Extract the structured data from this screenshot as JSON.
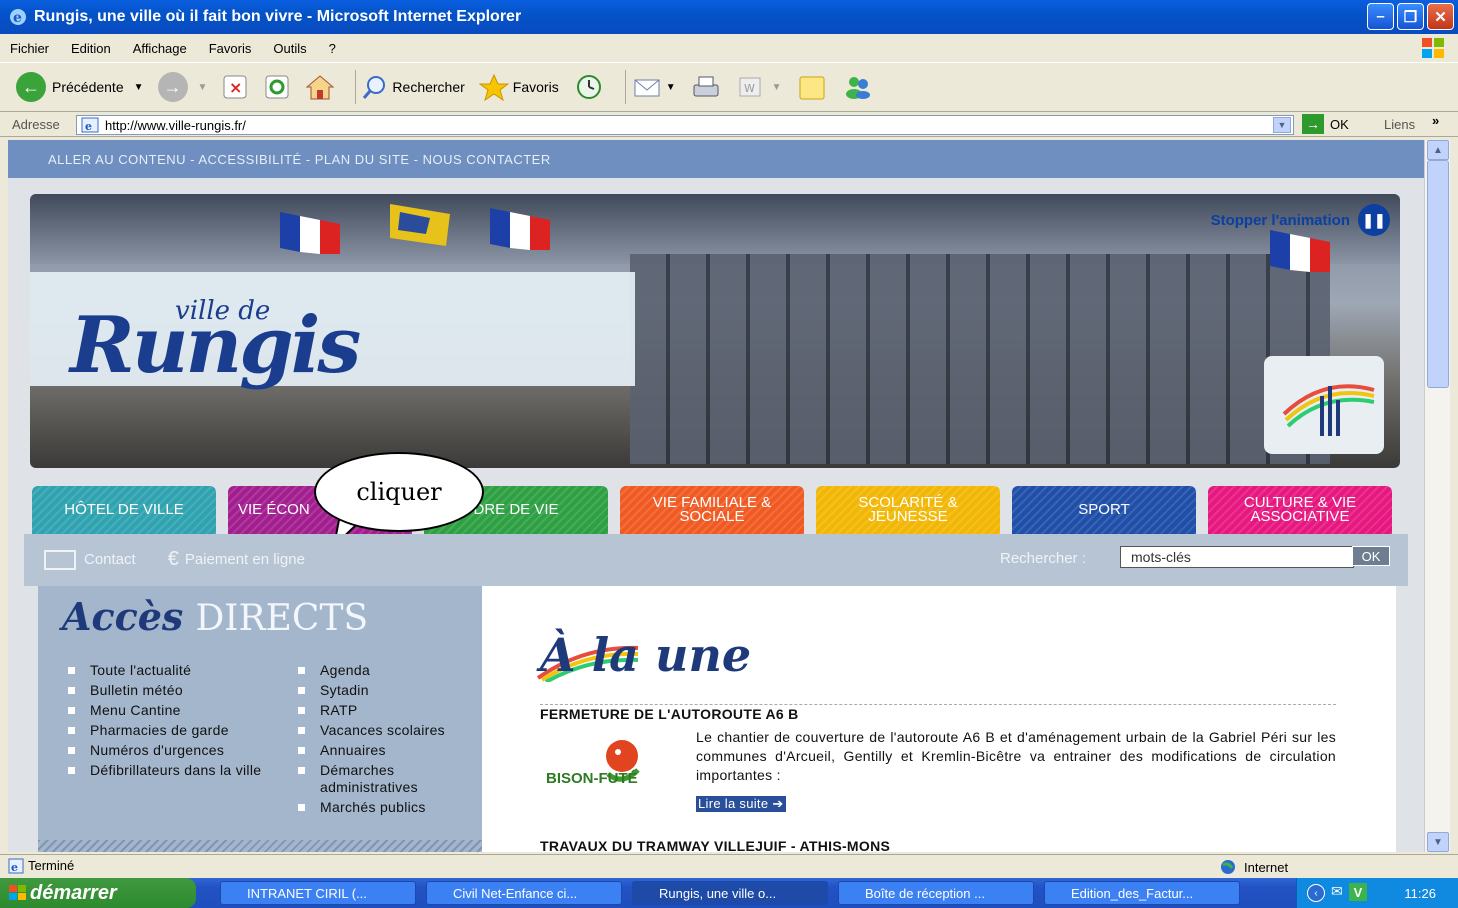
{
  "window": {
    "title": "Rungis, une ville où il fait bon vivre - Microsoft Internet Explorer",
    "menu": [
      "Fichier",
      "Edition",
      "Affichage",
      "Favoris",
      "Outils",
      "?"
    ]
  },
  "toolbar": {
    "back_label": "Précédente",
    "search_label": "Rechercher",
    "favorites_label": "Favoris"
  },
  "address": {
    "label": "Adresse",
    "url": "http://www.ville-rungis.fr/",
    "go_label": "OK",
    "links_label": "Liens"
  },
  "site": {
    "topnav": "ALLER AU CONTENU - ACCESSIBILITÉ - PLAN DU SITE - NOUS CONTACTER",
    "banner": {
      "logo_small": "ville de",
      "logo_big": "Rungis",
      "stop_animation": "Stopper l'animation"
    },
    "tabs": [
      {
        "label": "HÔTEL DE VILLE",
        "color": "#2fa3b0"
      },
      {
        "label": "VIE ÉCON",
        "color": "#a21e8e"
      },
      {
        "label": "DRE DE VIE",
        "color": "#2ea043"
      },
      {
        "label": "VIE FAMILIALE & SOCIALE",
        "color": "#f05a22"
      },
      {
        "label": "SCOLARITÉ & JEUNESSE",
        "color": "#f2b705"
      },
      {
        "label": "SPORT",
        "color": "#1f4fa8"
      },
      {
        "label": "CULTURE & VIE ASSOCIATIVE",
        "color": "#e6177f"
      }
    ],
    "bubble_text": "cliquer",
    "contact_label": "Contact",
    "payment_label": "Paiement en ligne",
    "search": {
      "label": "Rechercher :",
      "placeholder": "mots-clés",
      "ok": "OK"
    },
    "acces": {
      "title_a": "Accès",
      "title_b": "DIRECTS",
      "col1": [
        "Toute l'actualité",
        "Bulletin météo",
        "Menu Cantine",
        "Pharmacies de garde",
        "Numéros d'urgences",
        "Défibrillateurs dans la ville"
      ],
      "col2": [
        "Agenda",
        "Sytadin",
        "RATP",
        "Vacances scolaires",
        "Annuaires",
        "Démarches administratives",
        "Marchés publics"
      ]
    },
    "news": {
      "section_title": "À la une",
      "headline": "FERMETURE DE L'AUTOROUTE A6 B",
      "bison_label": "BISON-FUTÉ",
      "body": "Le chantier de couverture de l'autoroute A6 B et d'aménagement urbain de la Gabriel Péri sur les communes d'Arcueil, Gentilly et Kremlin-Bicêtre va entrainer des modifications de circulation importantes :",
      "read_more": "Lire la suite",
      "headline2": "TRAVAUX DU TRAMWAY VILLEJUIF - ATHIS-MONS"
    }
  },
  "status": {
    "text": "Terminé",
    "zone": "Internet"
  },
  "taskbar": {
    "start": "démarrer",
    "tasks": [
      "INTRANET CIRIL (...",
      "Civil Net-Enfance ci...",
      "Rungis, une ville o...",
      "Boîte de réception ...",
      "Edition_des_Factur..."
    ],
    "clock": "11:26"
  }
}
